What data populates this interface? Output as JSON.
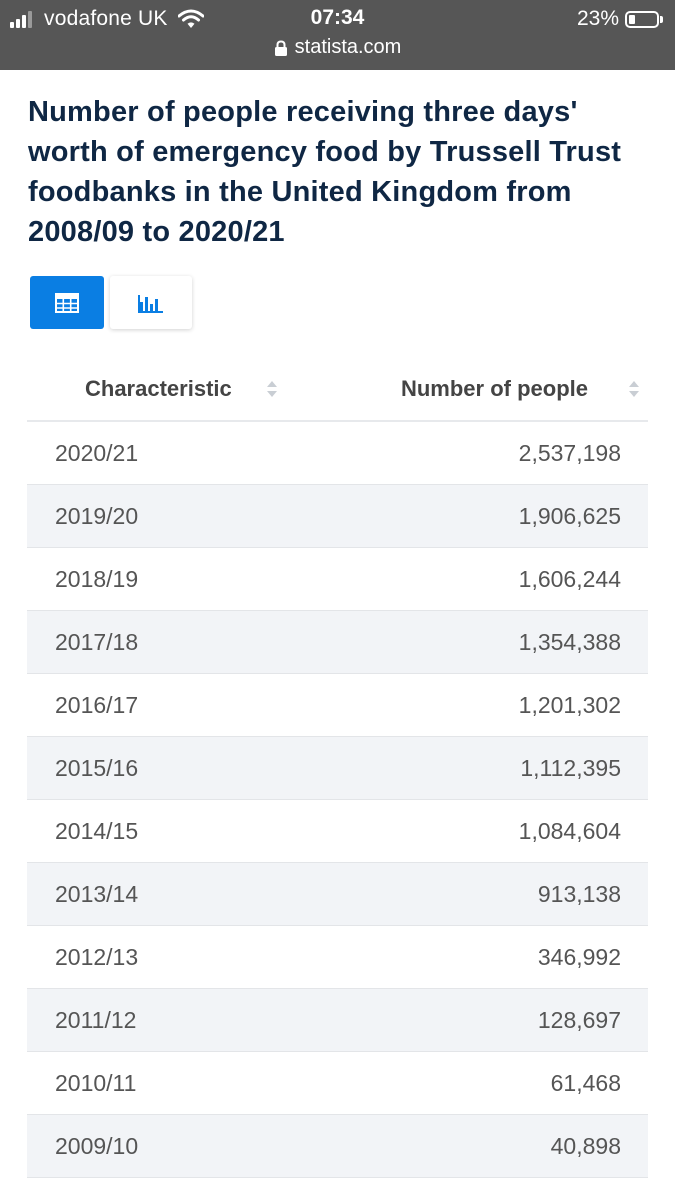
{
  "status_bar": {
    "carrier": "vodafone UK",
    "time": "07:34",
    "battery": "23%",
    "battery_level": 0.23,
    "url": "statista.com"
  },
  "title": "Number of people receiving three days' worth of emergency food by Trussell Trust foodbanks in the United Kingdom from 2008/09 to 2020/21",
  "view_toggle": {
    "active": "table",
    "options": [
      "table-icon",
      "bar-chart-icon"
    ]
  },
  "colors": {
    "status_bar": "#565656",
    "title": "#0f2744",
    "accent": "#0a7ee3",
    "row_stripe": "#f2f4f7"
  },
  "table": {
    "columns": [
      "Characteristic",
      "Number of people"
    ],
    "rows": [
      [
        "2020/21",
        "2,537,198"
      ],
      [
        "2019/20",
        "1,906,625"
      ],
      [
        "2018/19",
        "1,606,244"
      ],
      [
        "2017/18",
        "1,354,388"
      ],
      [
        "2016/17",
        "1,201,302"
      ],
      [
        "2015/16",
        "1,112,395"
      ],
      [
        "2014/15",
        "1,084,604"
      ],
      [
        "2013/14",
        "913,138"
      ],
      [
        "2012/13",
        "346,992"
      ],
      [
        "2011/12",
        "128,697"
      ],
      [
        "2010/11",
        "61,468"
      ],
      [
        "2009/10",
        "40,898"
      ]
    ]
  }
}
